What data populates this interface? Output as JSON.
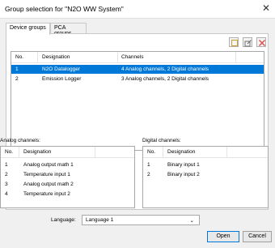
{
  "window": {
    "title": "Group selection for \"N2O WW System\"",
    "close_glyph": "✕"
  },
  "tabs": [
    {
      "label": "Device groups",
      "active": true
    },
    {
      "label": "PCA groups",
      "active": false
    }
  ],
  "toolbar": {
    "icons": [
      "new-icon",
      "edit-icon",
      "delete-icon"
    ]
  },
  "device_groups": {
    "headers": {
      "no": "No.",
      "designation": "Designation",
      "channels": "Channels"
    },
    "rows": [
      {
        "no": "1",
        "designation": "N2O Datalogger",
        "channels": "4 Analog channels, 2 Digital channels",
        "selected": true
      },
      {
        "no": "2",
        "designation": "Emission Logger",
        "channels": "3 Analog channels, 2 Digital channels",
        "selected": false
      }
    ]
  },
  "analog": {
    "label": "Analog channels:",
    "headers": {
      "no": "No.",
      "designation": "Designation"
    },
    "rows": [
      {
        "no": "1",
        "designation": "Analog output math 1"
      },
      {
        "no": "2",
        "designation": "Temperature input 1"
      },
      {
        "no": "3",
        "designation": "Analog output math 2"
      },
      {
        "no": "4",
        "designation": "Temperature input 2"
      }
    ]
  },
  "digital": {
    "label": "Digital channels:",
    "headers": {
      "no": "No.",
      "designation": "Designation"
    },
    "rows": [
      {
        "no": "1",
        "designation": "Binary input 1"
      },
      {
        "no": "2",
        "designation": "Binary input 2"
      }
    ]
  },
  "language": {
    "label": "Language:",
    "value": "Language 1",
    "chevron": "⌄"
  },
  "buttons": {
    "open": "Open",
    "cancel": "Cancel"
  },
  "colors": {
    "selection": "#0078d7",
    "delete_icon": "#d9534f"
  }
}
